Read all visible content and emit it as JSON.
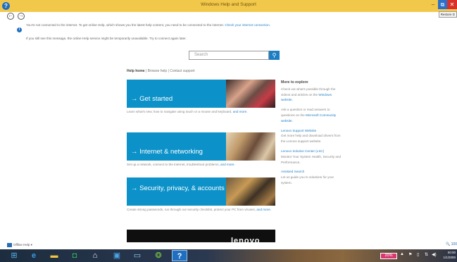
{
  "window": {
    "title": "Windows Help and Support",
    "minimize": "–",
    "restore": "⧉",
    "close": "✕",
    "tooltip": "Restore D"
  },
  "nav": {
    "back": "←",
    "forward": "→"
  },
  "info": {
    "line1_text": "You're not connected to the internet. To get online Help, which shows you the latest help content, you need to be connected to the internet. ",
    "line1_link": "Check your internet connection.",
    "line2_text": "If you still see this message, the online Help service might be temporarily unavailable. Try to connect again later."
  },
  "search": {
    "placeholder": "Search"
  },
  "breadcrumb": {
    "home": "Help home",
    "browse": "Browse help",
    "contact": "Contact support",
    "sep": " | "
  },
  "tiles": [
    {
      "label": "→ Get started",
      "desc_text": "Learn what's new, how to navigate using touch or a mouse and keyboard, ",
      "desc_link": "and more."
    },
    {
      "label": "→ Internet & networking",
      "desc_text": "Set up a network, connect to the internet, troubleshoot problems, ",
      "desc_link": "and more."
    },
    {
      "label": "→ Security, privacy, & accounts",
      "desc_text": "Create strong passwords, run through our security checklist, protect your PC from viruses, ",
      "desc_link": "and more."
    }
  ],
  "ad": {
    "brand": "lenovo"
  },
  "explore": {
    "heading": "More to explore",
    "p1_text": "Check out what's possible through the videos and articles on the ",
    "p1_link": "Windows website.",
    "p2_text": "Ask a question or read answers to questions on the ",
    "p2_link": "Microsoft Community website.",
    "p3_link": "Lenovo Support Website",
    "p3_text": "Get more help and download drivers from the Lenovo support website.",
    "p4_link": "Lenovo Solution Center (LSC)",
    "p4_text": "Monitor Your System Health, Security and Performance.",
    "p5_link": "Assisted Search",
    "p5_text": "Let us guide you to solutions for your system."
  },
  "status": {
    "left": "Offline Help ▾",
    "zoom": "🔍 100"
  },
  "taskbar": {
    "start": "⊞",
    "ie": "e",
    "explorer": "▬",
    "store": "◘",
    "home": "⌂",
    "photos": "▣",
    "monitor": "▭",
    "chrome": "❂",
    "help": "?",
    "battery": "20%",
    "tray1": "▲",
    "tray2": "⚑",
    "tray3": "▯",
    "tray4": "⇅",
    "tray5": "◀)",
    "clock_time": "00:00",
    "clock_date": "1/1/2000"
  }
}
